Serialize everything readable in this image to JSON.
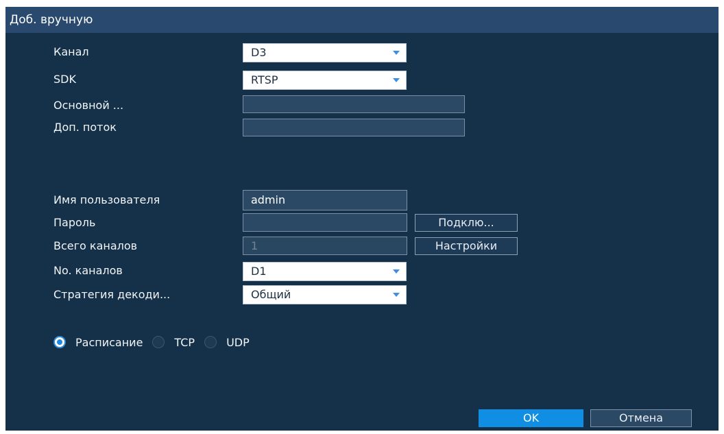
{
  "dialog": {
    "title": "Доб. вручную"
  },
  "form": {
    "channel": {
      "label": "Канал",
      "value": "D3"
    },
    "sdk": {
      "label": "SDK",
      "value": "RTSP"
    },
    "main_stream": {
      "label": "Основной ...",
      "value": ""
    },
    "sub_stream": {
      "label": "Доп. поток",
      "value": ""
    },
    "username": {
      "label": "Имя пользователя",
      "value": "admin"
    },
    "password": {
      "label": "Пароль",
      "value": ""
    },
    "connect_button": "Подклю...",
    "total_channels": {
      "label": "Всего каналов",
      "value": "1"
    },
    "settings_button": "Настройки",
    "channel_no": {
      "label": "No. каналов",
      "value": "D1"
    },
    "decode_strategy": {
      "label": "Стратегия декоди...",
      "value": "Общий"
    }
  },
  "transport": {
    "options": [
      {
        "label": "Расписание",
        "selected": true
      },
      {
        "label": "TCP",
        "selected": false
      },
      {
        "label": "UDP",
        "selected": false
      }
    ]
  },
  "footer": {
    "ok_label": "OK",
    "cancel_label": "Отмена"
  },
  "colors": {
    "panel_background": "#153049",
    "title_bar": "#294a6e",
    "accent": "#0f8ee4"
  }
}
